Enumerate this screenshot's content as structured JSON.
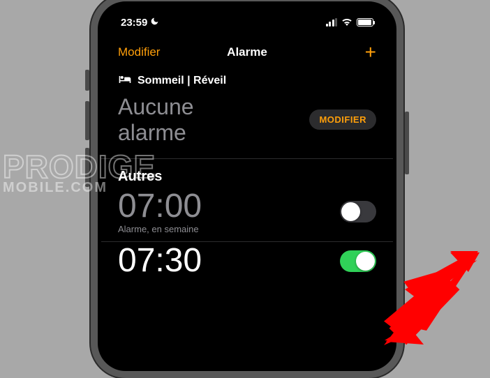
{
  "status": {
    "time": "23:59",
    "dnd_icon": "moon-icon"
  },
  "nav": {
    "left": "Modifier",
    "title": "Alarme",
    "add_icon": "plus-icon",
    "add_symbol": "+"
  },
  "sleep_section": {
    "header": "Sommeil | Réveil",
    "no_alarm_line1": "Aucune",
    "no_alarm_line2": "alarme",
    "modify_button": "MODIFIER"
  },
  "others_section": {
    "header": "Autres",
    "alarms": [
      {
        "time": "07:00",
        "label": "Alarme, en semaine",
        "enabled": false
      },
      {
        "time": "07:30",
        "label": "",
        "enabled": true
      }
    ]
  },
  "watermark": {
    "line1": "PRODIGE",
    "line2": "MOBILE.COM"
  },
  "colors": {
    "accent": "#ff9f0a",
    "toggle_on": "#30d158"
  }
}
